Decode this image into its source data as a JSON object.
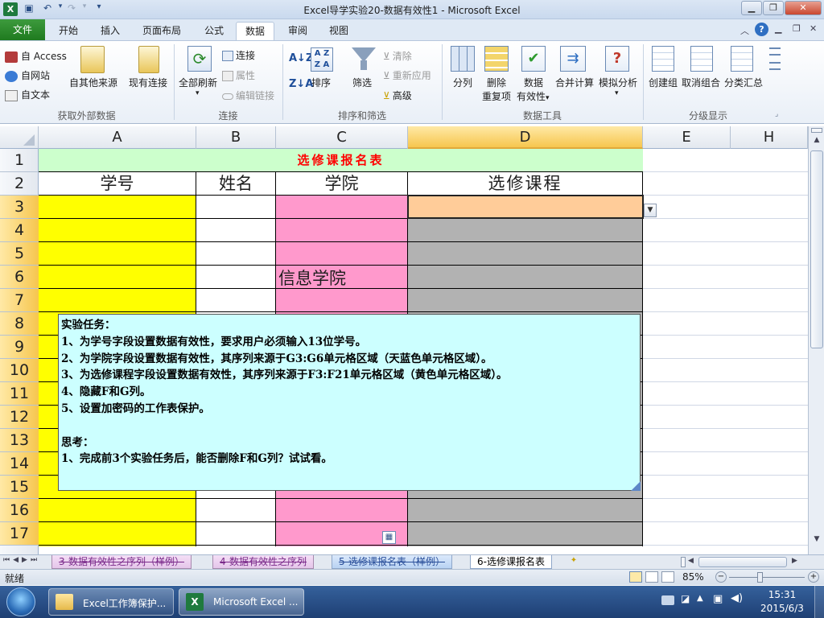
{
  "app": {
    "window_title": "Excel导学实验20-数据有效性1 - Microsoft Excel"
  },
  "tabs": {
    "file": "文件",
    "items": [
      "开始",
      "插入",
      "页面布局",
      "公式",
      "数据",
      "审阅",
      "视图"
    ],
    "active": "数据"
  },
  "ribbon": {
    "external": {
      "access": "自 Access",
      "web": "自网站",
      "text": "自文本",
      "other": "自其他来源",
      "existing": "现有连接",
      "label": "获取外部数据"
    },
    "connections": {
      "refresh_all": "全部刷新",
      "connections": "连接",
      "properties": "属性",
      "edit_links": "编辑链接",
      "label": "连接"
    },
    "sort_filter": {
      "sort": "排序",
      "filter": "筛选",
      "clear": "清除",
      "reapply": "重新应用",
      "advanced": "高级",
      "label": "排序和筛选"
    },
    "data_tools": {
      "text_to_columns": "分列",
      "remove_dup_1": "删除",
      "remove_dup_2": "重复项",
      "validation_1": "数据",
      "validation_2": "有效性",
      "consolidate": "合并计算",
      "what_if": "模拟分析",
      "label": "数据工具"
    },
    "outline": {
      "group": "创建组",
      "ungroup": "取消组合",
      "subtotal": "分类汇总",
      "label": "分级显示"
    }
  },
  "sheet": {
    "columns": [
      "A",
      "B",
      "C",
      "D",
      "E",
      "H"
    ],
    "rows": [
      "1",
      "2",
      "3",
      "4",
      "5",
      "6",
      "7",
      "8",
      "9",
      "10",
      "11",
      "12",
      "13",
      "14",
      "15",
      "16",
      "17"
    ],
    "title": "选修课报名表",
    "headers": [
      "学号",
      "姓名",
      "学院",
      "选修课程"
    ],
    "c6_value": "信息学院"
  },
  "comment": {
    "lines": [
      "实验任务：",
      "1、为学号字段设置数据有效性，要求用户必须输入13位学号。",
      "2、为学院字段设置数据有效性，其序列来源于G3:G6单元格区域（天蓝色单元格区域）。",
      "3、为选修课程字段设置数据有效性，其序列来源于F3:F21单元格区域（黄色单元格区域）。",
      "4、隐藏F和G列。",
      "5、设置加密码的工作表保护。",
      "",
      "思考：",
      "1、完成前3个实验任务后，能否删除F和G列？试试看。"
    ]
  },
  "sheet_tabs": {
    "items": [
      "3-数据有效性之序列（样例）",
      "4-数据有效性之序列",
      "5-选修课报名表（样例）",
      "6-选修课报名表"
    ],
    "active": "6-选修课报名表"
  },
  "status": {
    "mode": "就绪",
    "zoom": "85%"
  },
  "taskbar": {
    "items": [
      "Excel工作簿保护...",
      "Microsoft Excel ..."
    ],
    "time": "15:31",
    "date": "2015/6/3"
  },
  "colors": {
    "yellow": "#ffff00",
    "pink": "#ff99cc",
    "gray": "#b2b2b2",
    "orange": "#ffcc99",
    "title_bg": "#ccffcc",
    "title_text": "#ff0000",
    "comment_bg": "#ccffff",
    "accent_green": "#217346"
  }
}
